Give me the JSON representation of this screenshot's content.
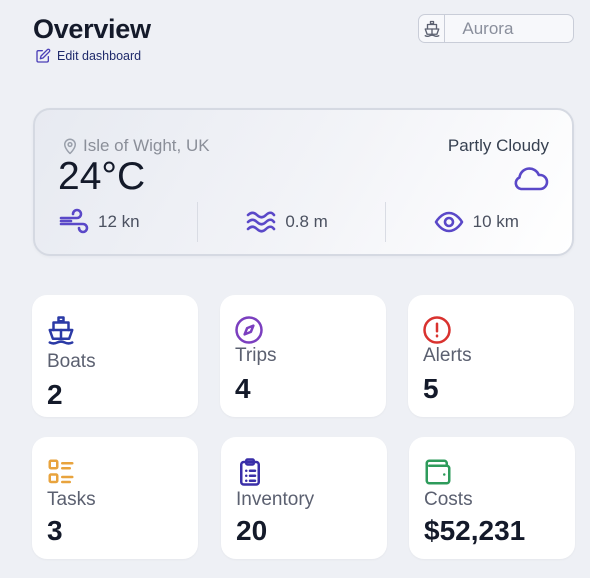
{
  "header": {
    "title": "Overview",
    "edit_label": "Edit dashboard"
  },
  "boat_selector": {
    "placeholder": "Aurora",
    "icon": "boat-icon"
  },
  "weather": {
    "location": "Isle of Wight, UK",
    "temperature": "24°C",
    "condition": "Partly Cloudy",
    "condition_icon": "cloud-icon",
    "wind": "12 kn",
    "waves": "0.8 m",
    "visibility": "10 km"
  },
  "cards": [
    {
      "label": "Boats",
      "value": "2",
      "icon": "boat-icon",
      "color": "#2b3aa6"
    },
    {
      "label": "Trips",
      "value": "4",
      "icon": "compass-icon",
      "color": "#7b3fbf"
    },
    {
      "label": "Alerts",
      "value": "5",
      "icon": "alert-icon",
      "color": "#d9322f"
    },
    {
      "label": "Tasks",
      "value": "3",
      "icon": "tasks-icon",
      "color": "#e8a33d"
    },
    {
      "label": "Inventory",
      "value": "20",
      "icon": "clipboard-icon",
      "color": "#3a2fa8"
    },
    {
      "label": "Costs",
      "value": "$52,231",
      "icon": "wallet-icon",
      "color": "#2e9b5b"
    }
  ],
  "colors": {
    "accent": "#5a48c8",
    "background": "#eef0f5"
  }
}
